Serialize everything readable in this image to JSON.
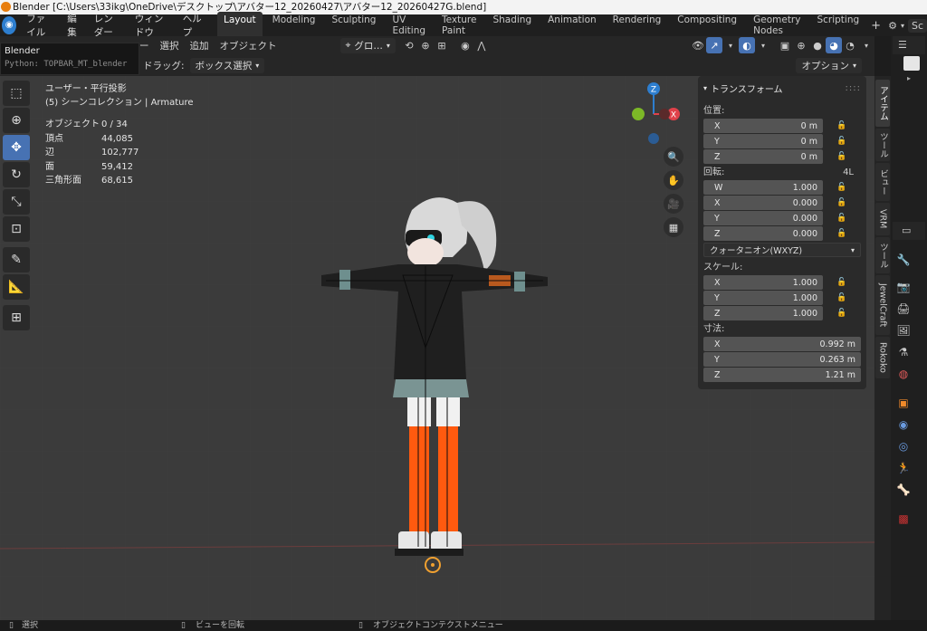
{
  "window": {
    "title": "Blender [C:\\Users\\33ikg\\OneDrive\\デスクトップ\\アバター12_20260427\\アバター12_20260427G.blend]"
  },
  "tooltip": {
    "title": "Blender",
    "python": "Python: TOPBAR_MT_blender"
  },
  "menu": [
    "ファイル",
    "編集",
    "レンダー",
    "ウィンドウ",
    "ヘルプ"
  ],
  "workspaces": [
    "Layout",
    "Modeling",
    "Sculpting",
    "UV Editing",
    "Texture Paint",
    "Shading",
    "Animation",
    "Rendering",
    "Compositing",
    "Geometry Nodes",
    "Scripting"
  ],
  "scene_label": "Sc",
  "header": {
    "menus": [
      "ー",
      "選択",
      "追加",
      "オブジェクト"
    ],
    "orientation": "グロ…",
    "drag_label": "ドラッグ:",
    "drag_value": "ボックス選択",
    "options": "オプション"
  },
  "overlay": {
    "view_name": "ユーザー・平行投影",
    "collection": "(5) シーンコレクション | Armature"
  },
  "stats": [
    {
      "key": "オブジェクト",
      "value": "0 / 34"
    },
    {
      "key": "頂点",
      "value": "44,085"
    },
    {
      "key": "辺",
      "value": "102,777"
    },
    {
      "key": "面",
      "value": "59,412"
    },
    {
      "key": "三角形面",
      "value": "68,615"
    }
  ],
  "gizmo": {
    "z": "Z",
    "x": "X"
  },
  "transform": {
    "header": "トランスフォーム",
    "location_label": "位置:",
    "location": [
      {
        "axis": "X",
        "value": "0 m"
      },
      {
        "axis": "Y",
        "value": "0 m"
      },
      {
        "axis": "Z",
        "value": "0 m"
      }
    ],
    "rotation_label": "回転:",
    "rotation_mode_short": "4L",
    "rotation": [
      {
        "axis": "W",
        "value": "1.000"
      },
      {
        "axis": "X",
        "value": "0.000"
      },
      {
        "axis": "Y",
        "value": "0.000"
      },
      {
        "axis": "Z",
        "value": "0.000"
      }
    ],
    "rotation_mode": "クォータニオン(WXYZ)",
    "scale_label": "スケール:",
    "scale": [
      {
        "axis": "X",
        "value": "1.000"
      },
      {
        "axis": "Y",
        "value": "1.000"
      },
      {
        "axis": "Z",
        "value": "1.000"
      }
    ],
    "dimensions_label": "寸法:",
    "dimensions": [
      {
        "axis": "X",
        "value": "0.992 m"
      },
      {
        "axis": "Y",
        "value": "0.263 m"
      },
      {
        "axis": "Z",
        "value": "1.21 m"
      }
    ]
  },
  "sidebar_tabs": [
    "アイテム",
    "ツール",
    "ビュー",
    "VRM",
    "ツール",
    "JewelCraft",
    "Rokoko"
  ],
  "status": {
    "select": "選択",
    "rotate": "ビューを回転",
    "context_menu": "オブジェクトコンテクストメニュー"
  },
  "colors": {
    "accent": "#4772b3",
    "axis_x": "#e0414a",
    "axis_y": "#7cb827",
    "axis_z": "#2d7ecf",
    "stocking": "#ff5a0f"
  }
}
